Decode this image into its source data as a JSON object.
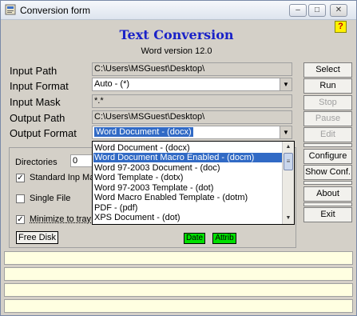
{
  "window": {
    "title": "Conversion form",
    "buttons": {
      "minimize": "–",
      "maximize": "□",
      "close": "✕"
    }
  },
  "header": {
    "title": "Text Conversion",
    "version": "Word version 12.0",
    "help": "?"
  },
  "form": {
    "input_path_label": "Input Path",
    "input_path_value": "C:\\Users\\MSGuest\\Desktop\\",
    "input_format_label": "Input Format",
    "input_format_value": "Auto - (*)",
    "input_mask_label": "Input Mask",
    "input_mask_value": "*.*",
    "output_path_label": "Output Path",
    "output_path_value": "C:\\Users\\MSGuest\\Desktop\\",
    "output_format_label": "Output Format",
    "output_format_value": "Word Document - (docx)"
  },
  "side_buttons": {
    "select": "Select",
    "run": "Run",
    "stop": "Stop",
    "pause": "Pause",
    "edit": "Edit",
    "configure": "Configure",
    "show_conf": "Show Conf.",
    "about": "About",
    "exit": "Exit"
  },
  "options": {
    "directories_label": "Directories",
    "directories_value": "0",
    "standard_input_label": "Standard Inp Ma",
    "standard_input_checked": true,
    "single_file_label": "Single File",
    "single_file_checked": false,
    "minimize_tray_label": "Minimize to tray",
    "minimize_tray_checked": true,
    "free_disk": "Free Disk",
    "date_badge": "Date",
    "attrib_badge": "Attrib"
  },
  "dropdown": {
    "highlighted_index": 1,
    "items": [
      "Word Document - (docx)",
      "Word Document Macro Enabled - (docm)",
      "Word 97-2003 Document - (doc)",
      "Word Template - (dotx)",
      "Word 97-2003 Template - (dot)",
      "Word Macro Enabled Template - (dotm)",
      "PDF - (pdf)",
      "XPS Document - (dot)"
    ]
  },
  "status_lines": [
    "",
    "",
    "",
    ""
  ],
  "colors": {
    "heading": "#1a22c8",
    "highlight": "#316ac5",
    "badge_green": "#00e000",
    "status_bg": "#ffffe1"
  }
}
